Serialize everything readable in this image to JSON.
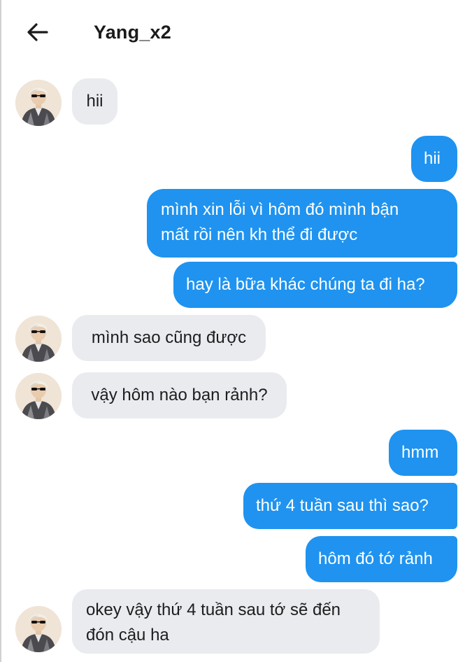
{
  "header": {
    "title": "Yang_x2"
  },
  "messages": [
    {
      "side": "in",
      "text": "hii"
    },
    {
      "side": "out",
      "text": "hii"
    },
    {
      "side": "out",
      "lines": [
        "mình xin lỗi vì hôm đó mình bận",
        "mất rồi nên kh thể đi được"
      ]
    },
    {
      "side": "out",
      "text": "hay là bữa khác chúng ta đi ha?"
    },
    {
      "side": "in",
      "text": "mình sao cũng được"
    },
    {
      "side": "in",
      "text": "vậy hôm nào bạn rảnh?"
    },
    {
      "side": "out",
      "text": "hmm"
    },
    {
      "side": "out",
      "text": "thứ 4 tuần sau thì sao?"
    },
    {
      "side": "out",
      "text": "hôm đó tớ rảnh"
    },
    {
      "side": "in",
      "lines": [
        "okey vậy thứ 4 tuần sau tớ sẽ đến",
        "đón cậu ha"
      ]
    }
  ],
  "colors": {
    "outgoing_bubble": "#1f93ef",
    "incoming_bubble": "#e9ebef",
    "background": "#ffffff"
  },
  "icons": {
    "back": "arrow-left-icon",
    "avatar": "contact-avatar"
  }
}
